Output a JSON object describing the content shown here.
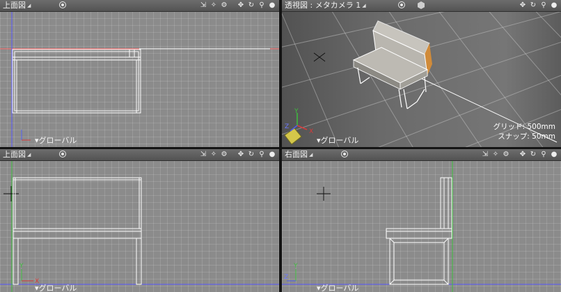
{
  "panes": {
    "top": {
      "title": "上面図",
      "mode": "グローバル"
    },
    "persp": {
      "title": "透視図 : メタカメラ 1",
      "mode": "グローバル",
      "grid_label": "グリッド: 500mm",
      "snap_label": "スナップ: 50mm"
    },
    "front": {
      "title": "上面図",
      "mode": "グローバル"
    },
    "right": {
      "title": "右面図",
      "mode": "グローバル"
    }
  },
  "axes": {
    "x": "X",
    "y": "Y",
    "z": "Z"
  },
  "icons": {
    "view_menu": "eye-icon",
    "render": "cube-icon",
    "tools": [
      "zoom-fit-icon",
      "magic-icon",
      "gear-icon",
      "move-icon",
      "rotate-icon",
      "zoom-icon",
      "sphere-icon"
    ]
  },
  "colors": {
    "x_axis": "#d63b3b",
    "y_axis": "#3dbf3d",
    "z_axis": "#4d5cf0",
    "wire": "#ffffff",
    "seat_top": "#bdbab3"
  }
}
